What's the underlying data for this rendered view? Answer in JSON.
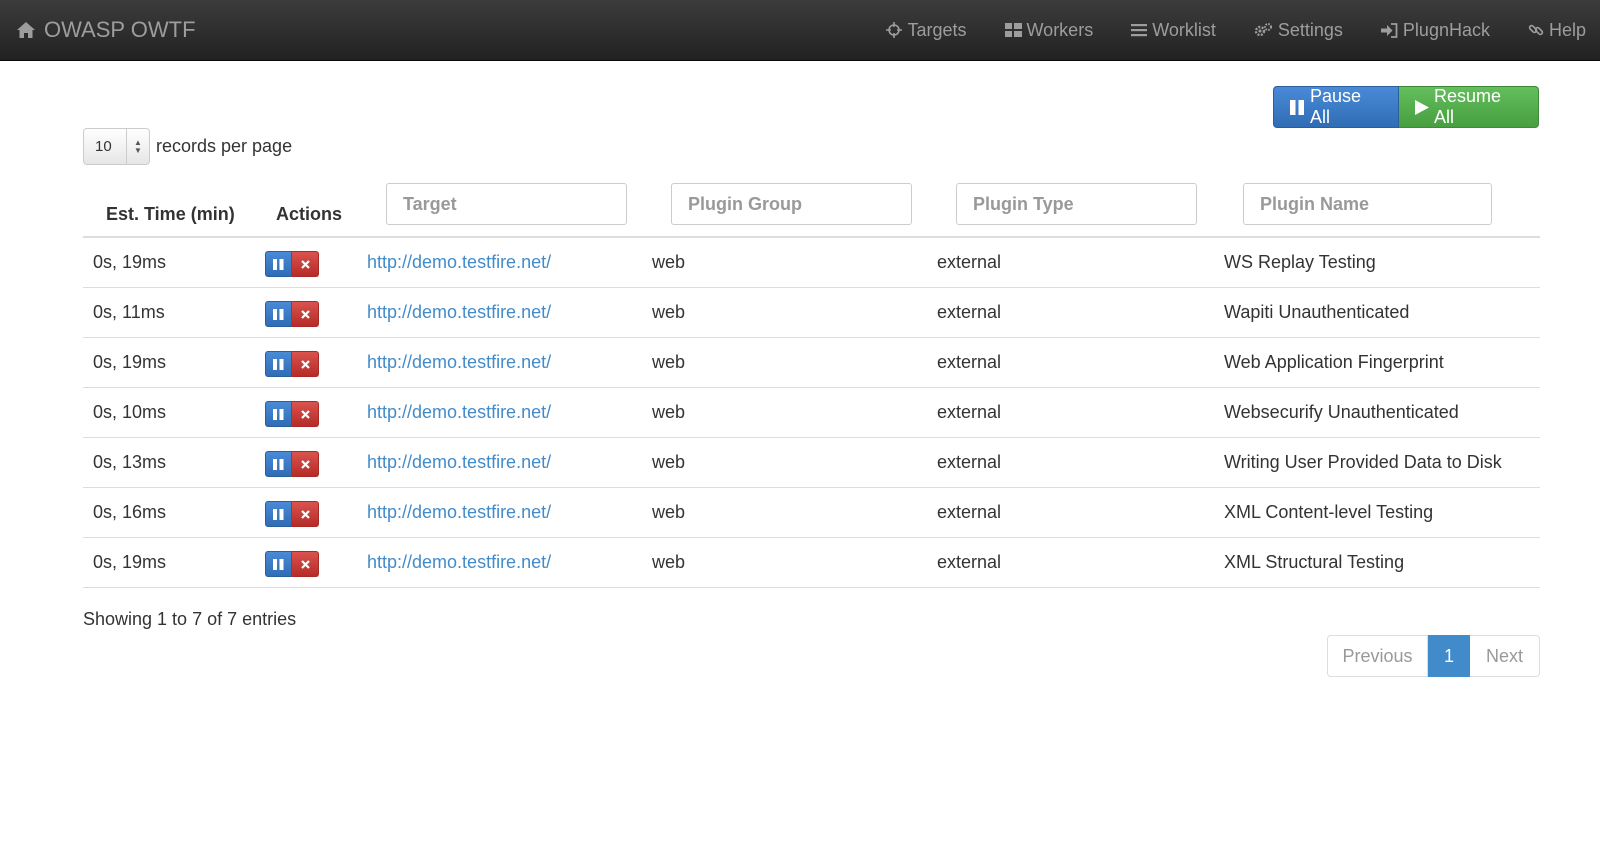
{
  "navbar": {
    "brand": "OWASP OWTF",
    "brand_icon": "home-icon",
    "items": [
      {
        "label": "Targets",
        "icon": "crosshair-icon"
      },
      {
        "label": "Workers",
        "icon": "grid-icon"
      },
      {
        "label": "Worklist",
        "icon": "list-icon"
      },
      {
        "label": "Settings",
        "icon": "gears-icon"
      },
      {
        "label": "PlugnHack",
        "icon": "sign-in-icon"
      },
      {
        "label": "Help",
        "icon": "link-icon"
      }
    ]
  },
  "controls": {
    "pause_all": "Pause All",
    "resume_all": "Resume All",
    "page_length": "10",
    "records_per_page": "records per page"
  },
  "table": {
    "headers": {
      "est_time": "Est. Time (min)",
      "actions": "Actions"
    },
    "filters": {
      "target": "Target",
      "plugin_group": "Plugin Group",
      "plugin_type": "Plugin Type",
      "plugin_name": "Plugin Name"
    },
    "rows": [
      {
        "time": "0s, 19ms",
        "target": "http://demo.testfire.net/",
        "group": "web",
        "type": "external",
        "name": "WS Replay Testing"
      },
      {
        "time": "0s, 11ms",
        "target": "http://demo.testfire.net/",
        "group": "web",
        "type": "external",
        "name": "Wapiti Unauthenticated"
      },
      {
        "time": "0s, 19ms",
        "target": "http://demo.testfire.net/",
        "group": "web",
        "type": "external",
        "name": "Web Application Fingerprint"
      },
      {
        "time": "0s, 10ms",
        "target": "http://demo.testfire.net/",
        "group": "web",
        "type": "external",
        "name": "Websecurify Unauthenticated"
      },
      {
        "time": "0s, 13ms",
        "target": "http://demo.testfire.net/",
        "group": "web",
        "type": "external",
        "name": "Writing User Provided Data to Disk"
      },
      {
        "time": "0s, 16ms",
        "target": "http://demo.testfire.net/",
        "group": "web",
        "type": "external",
        "name": "XML Content-level Testing"
      },
      {
        "time": "0s, 19ms",
        "target": "http://demo.testfire.net/",
        "group": "web",
        "type": "external",
        "name": "XML Structural Testing"
      }
    ]
  },
  "info": "Showing 1 to 7 of 7 entries",
  "pagination": {
    "previous": "Previous",
    "current": "1",
    "next": "Next"
  },
  "colors": {
    "navbar": "#222222",
    "link": "#428bca",
    "pause": "#3071a9",
    "resume": "#5cb85c",
    "delete": "#d9534f"
  }
}
